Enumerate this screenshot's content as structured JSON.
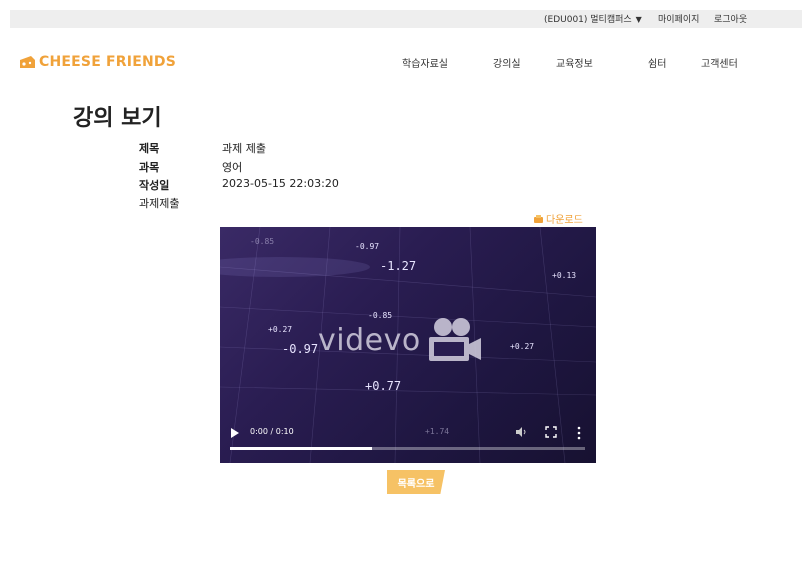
{
  "topbar": {
    "org_selector": "(EDU001) 멀티캠퍼스",
    "mypage": "마이페이지",
    "logout": "로그아웃"
  },
  "brand": {
    "logo_text": "CHEESE FRIENDS",
    "color": "#f0a23a"
  },
  "nav": [
    "학습자료실",
    "강의실",
    "교육정보",
    "쉼터",
    "고객센터"
  ],
  "page": {
    "title": "강의 보기"
  },
  "lecture": {
    "fields": [
      {
        "label": "제목",
        "value": "과제 제출"
      },
      {
        "label": "과목",
        "value": "영어"
      },
      {
        "label": "작성일",
        "value": "2023-05-15 22:03:20"
      }
    ],
    "description": "과제제출",
    "download_label": "다운로드"
  },
  "video": {
    "watermark": "videvo",
    "time": "0:00 / 0:10",
    "progress": 0.4,
    "overlay_numbers": [
      "-1.27",
      "+0.13",
      "-0.97",
      "+0.27",
      "+0.77",
      "+1.74",
      "-0.85",
      "-0.97",
      "+0.27",
      "-0.85"
    ]
  },
  "actions": {
    "back_to_list": "목록으로"
  },
  "colors": {
    "accent": "#f0a23a",
    "button_bg": "#f6c265",
    "topbar_bg": "#eeeeee"
  }
}
